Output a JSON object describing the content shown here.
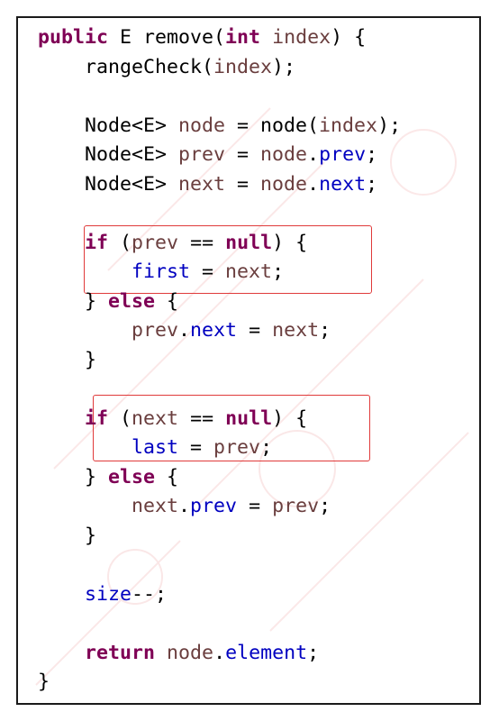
{
  "code_lines": [
    {
      "segments": [
        {
          "t": "public",
          "c": "kw"
        },
        {
          "t": " E remove(",
          "c": "plain"
        },
        {
          "t": "int",
          "c": "kw"
        },
        {
          "t": " ",
          "c": "plain"
        },
        {
          "t": "index",
          "c": "param"
        },
        {
          "t": ") {",
          "c": "plain"
        }
      ]
    },
    {
      "segments": [
        {
          "t": "    rangeCheck(",
          "c": "plain"
        },
        {
          "t": "index",
          "c": "param"
        },
        {
          "t": ");",
          "c": "plain"
        }
      ]
    },
    {
      "segments": []
    },
    {
      "segments": [
        {
          "t": "    Node<E> ",
          "c": "plain"
        },
        {
          "t": "node",
          "c": "local"
        },
        {
          "t": " = node(",
          "c": "plain"
        },
        {
          "t": "index",
          "c": "param"
        },
        {
          "t": ");",
          "c": "plain"
        }
      ]
    },
    {
      "segments": [
        {
          "t": "    Node<E> ",
          "c": "plain"
        },
        {
          "t": "prev",
          "c": "local"
        },
        {
          "t": " = ",
          "c": "plain"
        },
        {
          "t": "node",
          "c": "local"
        },
        {
          "t": ".",
          "c": "plain"
        },
        {
          "t": "prev",
          "c": "field"
        },
        {
          "t": ";",
          "c": "plain"
        }
      ]
    },
    {
      "segments": [
        {
          "t": "    Node<E> ",
          "c": "plain"
        },
        {
          "t": "next",
          "c": "local"
        },
        {
          "t": " = ",
          "c": "plain"
        },
        {
          "t": "node",
          "c": "local"
        },
        {
          "t": ".",
          "c": "plain"
        },
        {
          "t": "next",
          "c": "field"
        },
        {
          "t": ";",
          "c": "plain"
        }
      ]
    },
    {
      "segments": []
    },
    {
      "segments": [
        {
          "t": "    ",
          "c": "plain"
        },
        {
          "t": "if",
          "c": "kw"
        },
        {
          "t": " (",
          "c": "plain"
        },
        {
          "t": "prev",
          "c": "local"
        },
        {
          "t": " == ",
          "c": "plain"
        },
        {
          "t": "null",
          "c": "kw"
        },
        {
          "t": ") {",
          "c": "plain"
        }
      ]
    },
    {
      "segments": [
        {
          "t": "        ",
          "c": "plain"
        },
        {
          "t": "first",
          "c": "field"
        },
        {
          "t": " = ",
          "c": "plain"
        },
        {
          "t": "next",
          "c": "local"
        },
        {
          "t": ";",
          "c": "plain"
        }
      ]
    },
    {
      "segments": [
        {
          "t": "    } ",
          "c": "plain"
        },
        {
          "t": "else",
          "c": "kw"
        },
        {
          "t": " {",
          "c": "plain"
        }
      ]
    },
    {
      "segments": [
        {
          "t": "        ",
          "c": "plain"
        },
        {
          "t": "prev",
          "c": "local"
        },
        {
          "t": ".",
          "c": "plain"
        },
        {
          "t": "next",
          "c": "field"
        },
        {
          "t": " = ",
          "c": "plain"
        },
        {
          "t": "next",
          "c": "local"
        },
        {
          "t": ";",
          "c": "plain"
        }
      ]
    },
    {
      "segments": [
        {
          "t": "    }",
          "c": "plain"
        }
      ]
    },
    {
      "segments": []
    },
    {
      "segments": [
        {
          "t": "    ",
          "c": "plain"
        },
        {
          "t": "if",
          "c": "kw"
        },
        {
          "t": " (",
          "c": "plain"
        },
        {
          "t": "next",
          "c": "local"
        },
        {
          "t": " == ",
          "c": "plain"
        },
        {
          "t": "null",
          "c": "kw"
        },
        {
          "t": ") {",
          "c": "plain"
        }
      ]
    },
    {
      "segments": [
        {
          "t": "        ",
          "c": "plain"
        },
        {
          "t": "last",
          "c": "field"
        },
        {
          "t": " = ",
          "c": "plain"
        },
        {
          "t": "prev",
          "c": "local"
        },
        {
          "t": ";",
          "c": "plain"
        }
      ]
    },
    {
      "segments": [
        {
          "t": "    } ",
          "c": "plain"
        },
        {
          "t": "else",
          "c": "kw"
        },
        {
          "t": " {",
          "c": "plain"
        }
      ]
    },
    {
      "segments": [
        {
          "t": "        ",
          "c": "plain"
        },
        {
          "t": "next",
          "c": "local"
        },
        {
          "t": ".",
          "c": "plain"
        },
        {
          "t": "prev",
          "c": "field"
        },
        {
          "t": " = ",
          "c": "plain"
        },
        {
          "t": "prev",
          "c": "local"
        },
        {
          "t": ";",
          "c": "plain"
        }
      ]
    },
    {
      "segments": [
        {
          "t": "    }",
          "c": "plain"
        }
      ]
    },
    {
      "segments": []
    },
    {
      "segments": [
        {
          "t": "    ",
          "c": "plain"
        },
        {
          "t": "size",
          "c": "field"
        },
        {
          "t": "--;",
          "c": "plain"
        }
      ]
    },
    {
      "segments": []
    },
    {
      "segments": [
        {
          "t": "    ",
          "c": "plain"
        },
        {
          "t": "return",
          "c": "kw"
        },
        {
          "t": " ",
          "c": "plain"
        },
        {
          "t": "node",
          "c": "local"
        },
        {
          "t": ".",
          "c": "plain"
        },
        {
          "t": "element",
          "c": "field"
        },
        {
          "t": ";",
          "c": "plain"
        }
      ]
    },
    {
      "segments": [
        {
          "t": "}",
          "c": "plain"
        }
      ]
    }
  ],
  "colors": {
    "keyword": "#7f0055",
    "field": "#0000c0",
    "local": "#6a3e3e",
    "highlight_border": "#e03a3a",
    "frame_border": "#1a1a1a"
  }
}
